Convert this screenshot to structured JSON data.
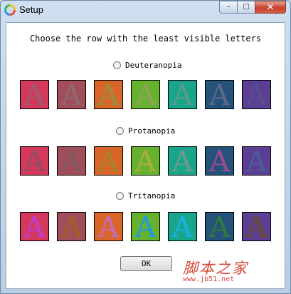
{
  "window": {
    "title": "Setup",
    "controls": {
      "minimize": "–",
      "maximize": "□",
      "close": "✕"
    }
  },
  "heading": "Choose the row with the least visible letters",
  "letter": "A",
  "rows": [
    {
      "option_label": "Deuteranopia",
      "swatches": [
        {
          "bg": "#d2395a",
          "fg": "#9d5a70"
        },
        {
          "bg": "#a24d5a",
          "fg": "#8d6a72"
        },
        {
          "bg": "#d76628",
          "fg": "#988e3e"
        },
        {
          "bg": "#66b22f",
          "fg": "#8fa25a"
        },
        {
          "bg": "#19a58a",
          "fg": "#5b9b8e"
        },
        {
          "bg": "#25527a",
          "fg": "#5a6a86"
        },
        {
          "bg": "#5c3f92",
          "fg": "#594d8e"
        }
      ]
    },
    {
      "option_label": "Protanopia",
      "swatches": [
        {
          "bg": "#d2395a",
          "fg": "#8d4e66"
        },
        {
          "bg": "#a24d5a",
          "fg": "#7e5a62"
        },
        {
          "bg": "#d76628",
          "fg": "#a4852e"
        },
        {
          "bg": "#66b22f",
          "fg": "#a9ad3f"
        },
        {
          "bg": "#19a58a",
          "fg": "#6b9a90"
        },
        {
          "bg": "#25527a",
          "fg": "#9e4b8e"
        },
        {
          "bg": "#5c3f92",
          "fg": "#4b5e9c"
        }
      ]
    },
    {
      "option_label": "Tritanopia",
      "swatches": [
        {
          "bg": "#d2395a",
          "fg": "#c23ad8"
        },
        {
          "bg": "#a24d5a",
          "fg": "#a06020"
        },
        {
          "bg": "#d76628",
          "fg": "#c56bb8"
        },
        {
          "bg": "#66b22f",
          "fg": "#1f9ce0"
        },
        {
          "bg": "#19a58a",
          "fg": "#1ab0e6"
        },
        {
          "bg": "#25527a",
          "fg": "#2f7a3c"
        },
        {
          "bg": "#5c3f92",
          "fg": "#6a4a2a"
        }
      ]
    }
  ],
  "ok_button": "OK",
  "watermark": {
    "title": "脚本之家",
    "url": "www.jb51.net"
  }
}
